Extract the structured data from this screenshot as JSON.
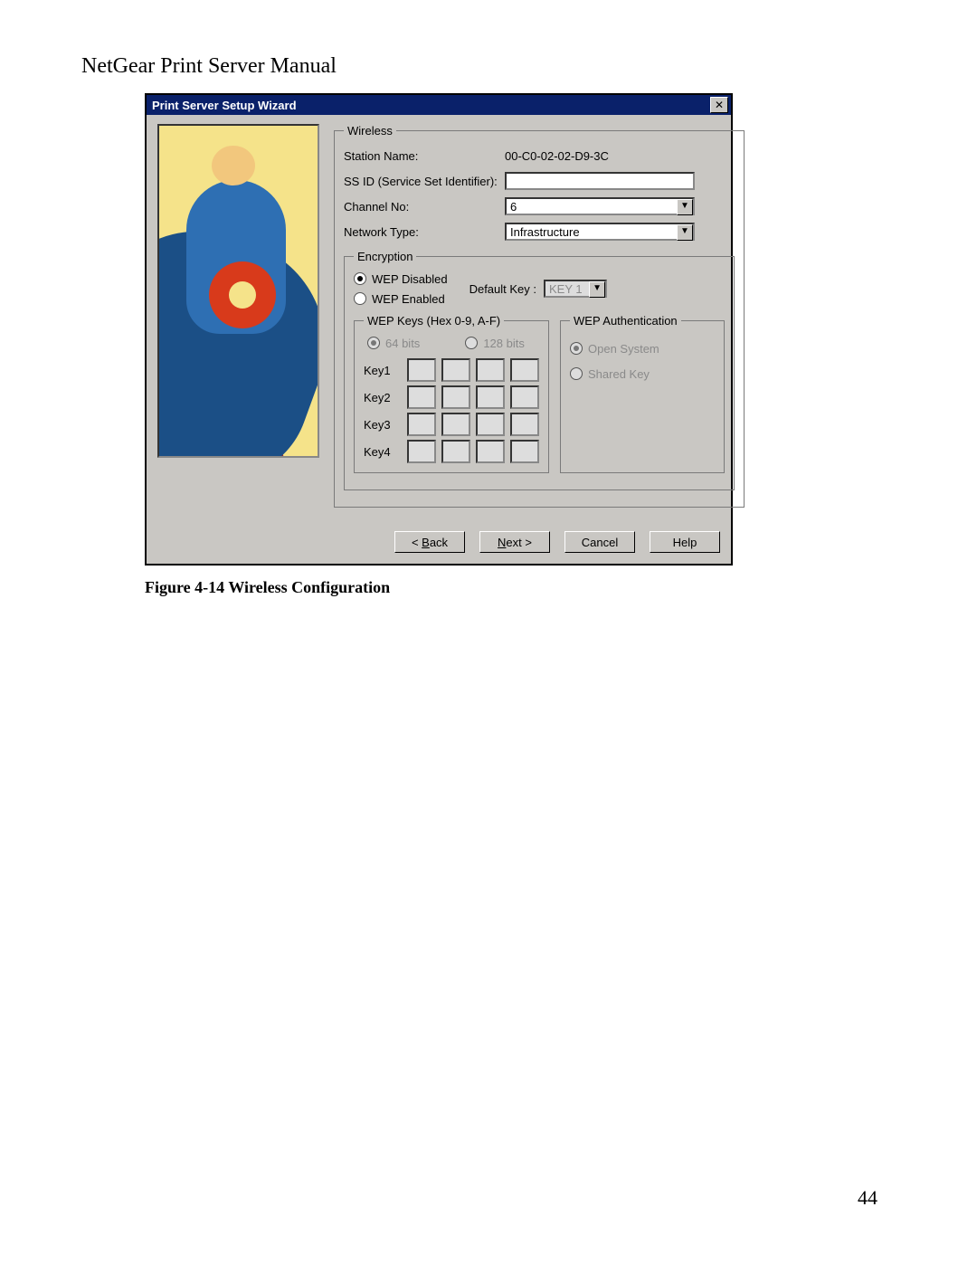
{
  "document": {
    "header": "NetGear Print Server Manual",
    "caption": "Figure 4-14 Wireless Configuration",
    "page_number": "44"
  },
  "window": {
    "title": "Print Server Setup Wizard"
  },
  "wireless": {
    "legend": "Wireless",
    "station_name_label": "Station Name:",
    "station_name_value": "00-C0-02-02-D9-3C",
    "ssid_label": "SS ID (Service Set Identifier):",
    "ssid_value": "",
    "channel_label": "Channel No:",
    "channel_value": "6",
    "network_type_label": "Network Type:",
    "network_type_value": "Infrastructure"
  },
  "encryption": {
    "legend": "Encryption",
    "wep_disabled_label": "WEP Disabled",
    "wep_enabled_label": "WEP Enabled",
    "wep_selected": "disabled",
    "default_key_label": "Default Key :",
    "default_key_value": "KEY 1",
    "wep_keys": {
      "legend": "WEP Keys (Hex 0-9, A-F)",
      "bits64_label": "64 bits",
      "bits128_label": "128 bits",
      "bits_selected": "64",
      "key_labels": [
        "Key1",
        "Key2",
        "Key3",
        "Key4"
      ]
    },
    "wep_auth": {
      "legend": "WEP Authentication",
      "open_system_label": "Open System",
      "shared_key_label": "Shared Key",
      "selected": "open"
    }
  },
  "buttons": {
    "back_prefix": "< ",
    "back_ul": "B",
    "back_suffix": "ack",
    "next_ul": "N",
    "next_suffix": "ext >",
    "cancel": "Cancel",
    "help": "Help"
  }
}
